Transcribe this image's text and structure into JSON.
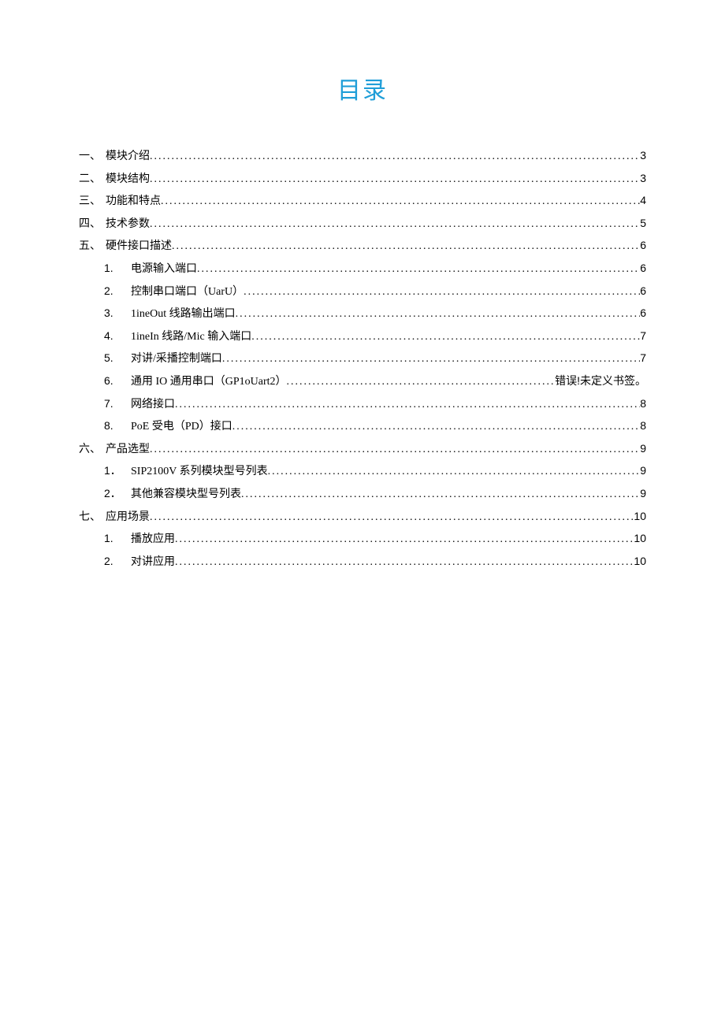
{
  "title": "目录",
  "entries": [
    {
      "level": 0,
      "num": "一、",
      "label": "模块介绍",
      "page": "3"
    },
    {
      "level": 0,
      "num": "二、",
      "label": "模块结构",
      "page": "3"
    },
    {
      "level": 0,
      "num": "三、",
      "label": "功能和特点",
      "page": "4"
    },
    {
      "level": 0,
      "num": "四、",
      "label": "技术参数",
      "page": "5"
    },
    {
      "level": 0,
      "num": "五、",
      "label": "硬件接口描述",
      "page": "6"
    },
    {
      "level": 1,
      "num": "1.",
      "label": "电源输入端口",
      "page": "6"
    },
    {
      "level": 1,
      "num": "2.",
      "label": "控制串口端口（UarU）",
      "page": "6"
    },
    {
      "level": 1,
      "num": "3.",
      "label": "1ineOut 线路输出端口",
      "page": "6"
    },
    {
      "level": 1,
      "num": "4.",
      "label": "1ineIn 线路/Mic 输入端口",
      "page": "7"
    },
    {
      "level": 1,
      "num": "5.",
      "label": "对讲/采播控制端口",
      "page": "7"
    },
    {
      "level": 1,
      "num": "6.",
      "label": "通用 IO 通用串口（GP1oUart2）",
      "page": "错误!未定义书签。"
    },
    {
      "level": 1,
      "num": "7.",
      "label": "网络接口",
      "page": "8"
    },
    {
      "level": 1,
      "num": "8.",
      "label": "PoE 受电（PD）接口",
      "page": "8"
    },
    {
      "level": 0,
      "num": "六、",
      "label": "产品选型",
      "page": "9"
    },
    {
      "level": 1,
      "num": "1．",
      "label": "SIP2100V 系列模块型号列表",
      "page": "9"
    },
    {
      "level": 1,
      "num": "2．",
      "label": "其他兼容模块型号列表",
      "page": "9"
    },
    {
      "level": 0,
      "num": "七、",
      "label": "应用场景",
      "page": "10"
    },
    {
      "level": 1,
      "num": "1.",
      "label": "播放应用",
      "page": "10"
    },
    {
      "level": 1,
      "num": "2.",
      "label": "对讲应用",
      "page": "10"
    }
  ]
}
